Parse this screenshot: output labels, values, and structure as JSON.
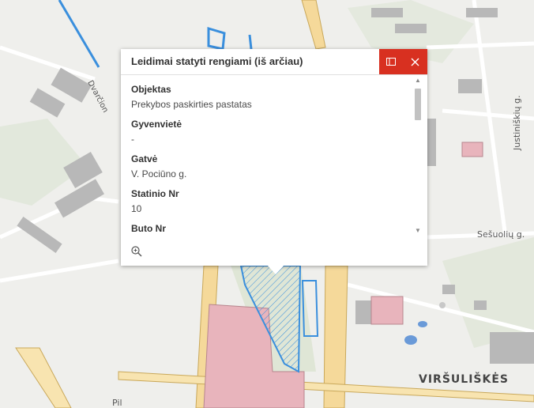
{
  "map": {
    "district_label": "VIRŠULIŠKĖS",
    "streets": {
      "sesuoliu": "Sešuolių g.",
      "justiniskiu": "Justiniškių g.",
      "pil": "Pil",
      "dvarcion": "Dvarčion"
    },
    "colors": {
      "background": "#efefec",
      "highlight": "#3a8fdd",
      "commercial": "#e8b4bc",
      "road_major": "#f5d99a",
      "building": "#b8b8b8"
    }
  },
  "popup": {
    "title": "Leidimai statyti rengiami (iš arčiau)",
    "dock_icon": "dock-icon",
    "close_icon": "close-icon",
    "zoom_icon": "zoom-to-icon",
    "fields": [
      {
        "label": "Objektas",
        "value": "Prekybos paskirties pastatas"
      },
      {
        "label": "Gyvenvietė",
        "value": "-"
      },
      {
        "label": "Gatvė",
        "value": "V. Pociūno g."
      },
      {
        "label": "Statinio Nr",
        "value": "10"
      },
      {
        "label": "Buto Nr",
        "value": ""
      }
    ],
    "accent": "#d83020"
  }
}
